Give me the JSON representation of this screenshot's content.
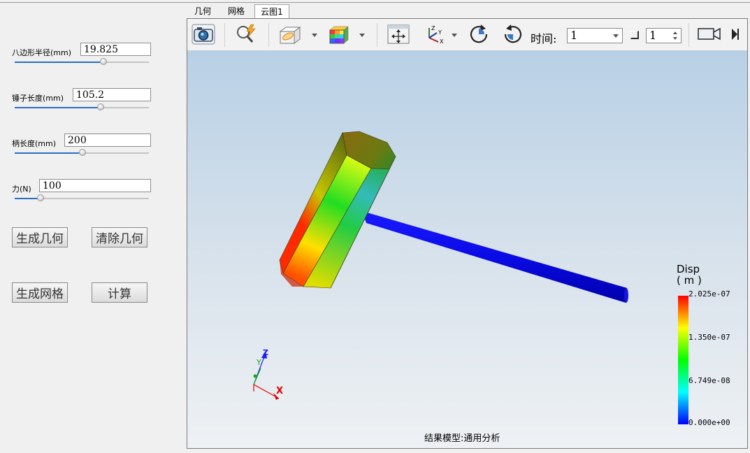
{
  "params": [
    {
      "label": "八边形半径(mm)",
      "value": "19.825",
      "fraction": 0.64
    },
    {
      "label": "锤子长度(mm)",
      "value": "105.2",
      "fraction": 0.62
    },
    {
      "label": "柄长度(mm)",
      "value": "200",
      "fraction": 0.49
    },
    {
      "label": "力(N)",
      "value": "100",
      "fraction": 0.19
    }
  ],
  "buttons": {
    "generate_geometry": "生成几何",
    "clear_geometry": "清除几何",
    "generate_mesh": "生成网格",
    "compute": "计算"
  },
  "tabs": [
    {
      "label": "几何",
      "active": false
    },
    {
      "label": "网格",
      "active": false
    },
    {
      "label": "云图1",
      "active": true
    }
  ],
  "toolbar": {
    "icons": [
      "camera-icon",
      "zoom-fit-icon",
      "clip-plane-icon",
      "color-cube-icon",
      "pan-icon",
      "axes-view-icon",
      "rotate-cw-icon",
      "rotate-ccw-icon",
      "record-icon",
      "expand-icon"
    ],
    "time_label": "时间:",
    "time_value": "1",
    "step_value": "1"
  },
  "legend": {
    "title": "Disp",
    "unit": "( m )",
    "max": "2.025e-07",
    "mid_high": "1.350e-07",
    "mid_low": "6.749e-08",
    "min": "0.000e+00",
    "colors": [
      "#ff0000",
      "#ffff00",
      "#00ff00",
      "#00ffff",
      "#0000ff"
    ]
  },
  "axes": {
    "x": "X",
    "y": "Y",
    "z": "Z"
  },
  "footer": "结果模型:通用分析"
}
